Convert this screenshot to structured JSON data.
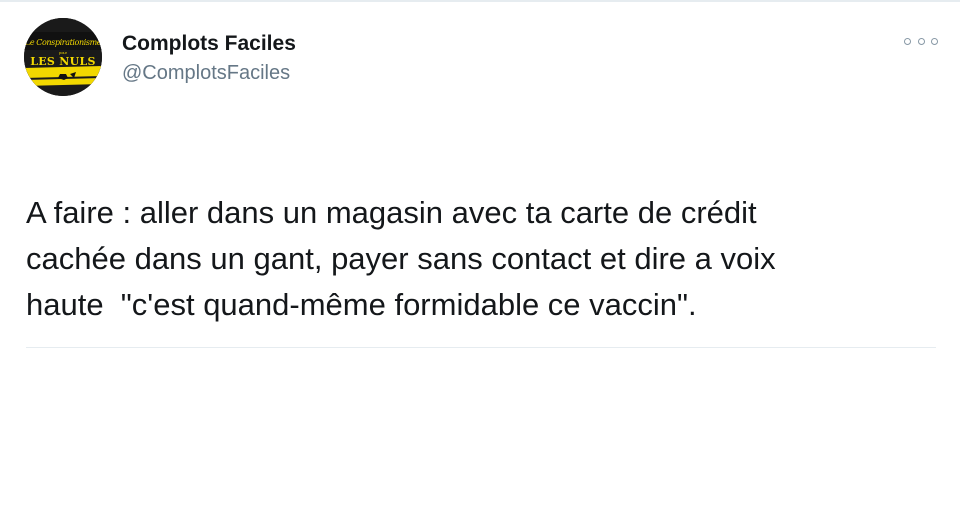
{
  "tweet": {
    "author": {
      "display_name": "Complots Faciles",
      "handle": "@ComplotsFaciles",
      "avatar": {
        "line1": "Le Conspirationisme",
        "line2": "pour",
        "line3": "LES NULS",
        "icon": "book-cover-avatar",
        "colors": {
          "background": "#1a1a1a",
          "accent": "#f2d800"
        }
      }
    },
    "more_icon": "more-options-icon",
    "text": "A faire : aller dans un magasin avec ta carte de crédit\ncachée dans un gant, payer sans contact et dire a voix\nhaute  \"c'est quand-même formidable ce vaccin\"."
  }
}
